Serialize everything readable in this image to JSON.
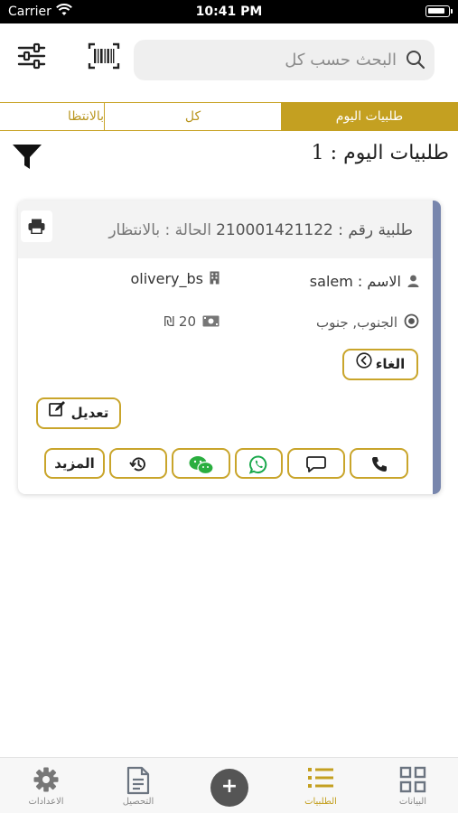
{
  "status_bar": {
    "carrier": "Carrier",
    "time": "10:41 PM",
    "icons": [
      "wifi-icon",
      "battery-icon"
    ]
  },
  "header": {
    "search_placeholder": "البحث حسب كل",
    "icons": [
      "settings-sliders-icon",
      "barcode-scan-icon",
      "search-icon"
    ]
  },
  "tabs": [
    {
      "label": "طلبيات اليوم",
      "active": true
    },
    {
      "label": "كل",
      "active": false
    },
    {
      "label": "بالانتظا",
      "active": false
    }
  ],
  "orders_title": "طلبيات اليوم : 1",
  "order": {
    "number_text": "طلبية رقم : 210001421122",
    "status_text": "الحالة : بالانتظار",
    "name_text": "الاسم : salem",
    "store": "olivery_bs",
    "address": "الجنوب, جنوب",
    "price": "20 ₪",
    "cancel_label": "الغاء",
    "edit_label": "تعديل",
    "more_label": "المزيد",
    "accent_color": "#7886ad"
  },
  "bottom_nav": [
    {
      "label": "الاعدادات",
      "icon": "gear-icon",
      "active": false
    },
    {
      "label": "التحصيل",
      "icon": "document-icon",
      "active": false
    },
    {
      "label": "+",
      "icon": "add-icon",
      "active": false
    },
    {
      "label": "الطلبيات",
      "icon": "list-icon",
      "active": true
    },
    {
      "label": "البيانات",
      "icon": "grid-icon",
      "active": false
    }
  ],
  "colors": {
    "brand_gold": "#c4a021",
    "nav_inactive": "#8a8a8a"
  }
}
